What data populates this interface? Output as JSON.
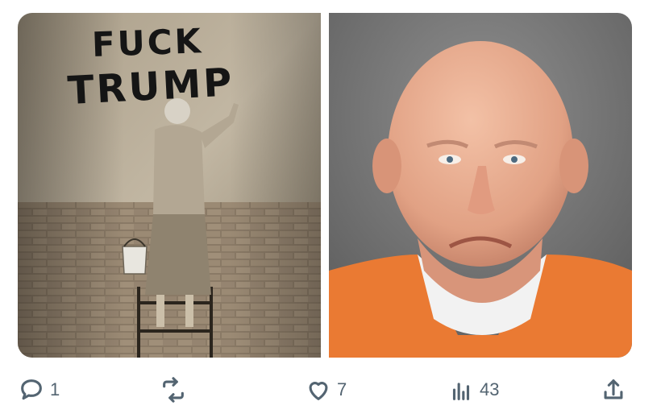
{
  "media": {
    "left_image": {
      "description_icon": "photo-graffiti",
      "graffiti_text": "FUCK TRUMP"
    },
    "right_image": {
      "description_icon": "photo-portrait"
    }
  },
  "actions": {
    "reply_count": "1",
    "repost_count": "",
    "like_count": "7",
    "views_count": "43",
    "icons": {
      "reply": "reply-icon",
      "repost": "repost-icon",
      "like": "heart-icon",
      "views": "views-bar-chart-icon",
      "share": "share-upload-icon"
    }
  },
  "colors": {
    "icon_gray": "#536471",
    "prison_orange": "#ea7a33",
    "wall_tone": "#b9ad98"
  }
}
